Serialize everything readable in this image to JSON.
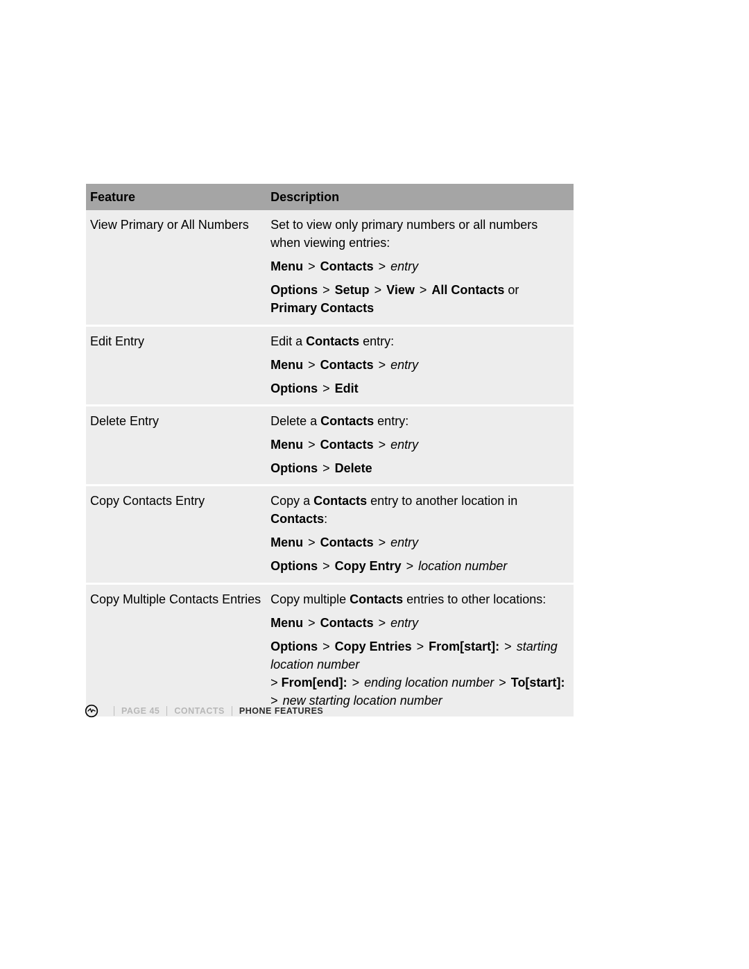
{
  "table": {
    "headers": {
      "feature": "Feature",
      "description": "Description"
    },
    "rows": [
      {
        "feature": "View Primary or All Numbers",
        "intro_pre": "Set to view only primary numbers or all numbers when viewing entries:",
        "path1": {
          "a": "Menu",
          "b": "Contacts",
          "c_italic": "entry"
        },
        "path2": {
          "a": "Options",
          "b": "Setup",
          "c": " View",
          "d": "All Contacts",
          "sep_or": " or ",
          "e": "Primary Contacts"
        }
      },
      {
        "feature": "Edit Entry",
        "intro_pre": "Edit a ",
        "intro_bold": "Contacts",
        "intro_post": " entry:",
        "path1": {
          "a": "Menu",
          "b": "Contacts",
          "c_italic": "entry"
        },
        "path2": {
          "a": "Options",
          "b": "Edit"
        }
      },
      {
        "feature": "Delete Entry",
        "intro_pre": "Delete a ",
        "intro_bold": "Contacts",
        "intro_post": " entry:",
        "path1": {
          "a": "Menu",
          "b": "Contacts",
          "c_italic": "entry"
        },
        "path2": {
          "a": "Options",
          "b": "Delete"
        }
      },
      {
        "feature": "Copy Contacts Entry",
        "intro_pre": "Copy a ",
        "intro_bold": "Contacts",
        "intro_post": " entry to another location in ",
        "intro_bold2": "Contacts",
        "intro_tail": ":",
        "path1": {
          "a": "Menu",
          "b": "Contacts",
          "c_italic": "entry"
        },
        "path2": {
          "a": "Options",
          "b": "Copy Entry",
          "c_italic": "location number"
        }
      },
      {
        "feature": "Copy Multiple Contacts Entries",
        "intro_pre": "Copy multiple ",
        "intro_bold": "Contacts",
        "intro_post": " entries to other locations:",
        "path1": {
          "a": "Menu",
          "b": "Contacts",
          "c_italic": "entry"
        },
        "path3": {
          "a": "Options",
          "b": "Copy Entries",
          "c": "From[start]:",
          "c_it": "starting location number",
          "d_pre": "> ",
          "d": "From[end]:",
          "d_it": "ending location number",
          "e": "To[start]:",
          "e_it": "new starting location number"
        }
      }
    ]
  },
  "footer": {
    "page": "PAGE 45",
    "section": "CONTACTS",
    "title": "PHONE FEATURES"
  }
}
